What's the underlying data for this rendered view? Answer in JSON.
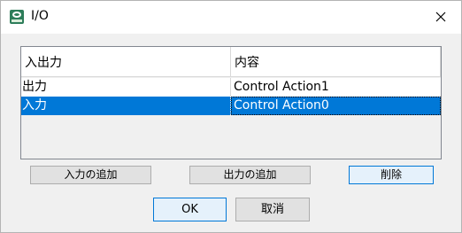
{
  "window": {
    "title": "I/O",
    "app_icon": "app-icon",
    "close_icon": "close-icon"
  },
  "table": {
    "headers": [
      "入出力",
      "内容"
    ],
    "rows": [
      {
        "io": "出力",
        "content": "Control Action1",
        "selected": false
      },
      {
        "io": "入力",
        "content": "Control Action0",
        "selected": true
      }
    ]
  },
  "buttons": {
    "add_input": "入力の追加",
    "add_output": "出力の追加",
    "delete": "削除",
    "ok": "OK",
    "cancel": "取消"
  },
  "colors": {
    "selection": "#0078d7",
    "dialog_background": "#f0f0f0"
  }
}
